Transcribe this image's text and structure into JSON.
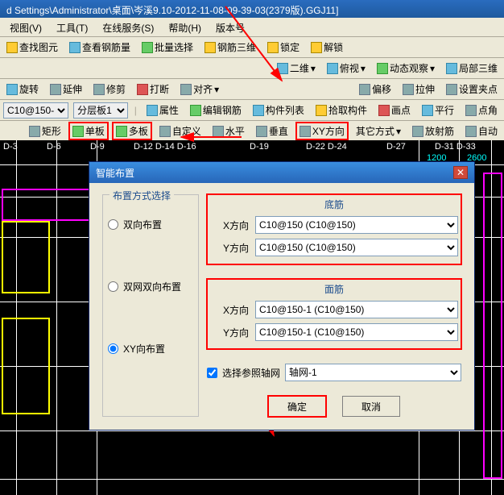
{
  "titlebar": "d Settings\\Administrator\\桌面\\岑溪9.10-2012-11-08-09-39-03(2379版).GGJ11]",
  "menu": [
    "视图(V)",
    "工具(T)",
    "在线服务(S)",
    "帮助(H)",
    "版本号"
  ],
  "tb1": {
    "find": "查找图元",
    "rebar": "查看钢筋量",
    "batch": "批量选择",
    "rebar3d": "钢筋三维",
    "lock": "锁定",
    "unlock": "解锁"
  },
  "tb2": {
    "d2": "二维",
    "pan": "俯视",
    "obs": "动态观察",
    "local3d": "局部三维"
  },
  "tb3": {
    "rotate": "旋转",
    "extend": "延伸",
    "trim": "修剪",
    "break": "打断",
    "align": "对齐",
    "offset": "偏移",
    "stretch": "拉伸",
    "pivot": "设置夹点"
  },
  "tb4": {
    "combo": "C10@150-",
    "layer": "分层板1",
    "props": "属性",
    "editrebar": "编辑钢筋",
    "complist": "构件列表",
    "pick": "拾取构件",
    "drawpt": "画点",
    "parallel": "平行",
    "ptangle": "点角"
  },
  "tb5": {
    "rect": "矩形",
    "single": "单板",
    "multi": "多板",
    "custom": "自定义",
    "hor": "水平",
    "vert": "垂直",
    "xy": "XY方向",
    "other": "其它方式",
    "radial": "放射筋",
    "auto": "自动"
  },
  "gridlabels": [
    "D-3",
    "D-6",
    "D-9",
    "D-12 D-14 D-16",
    "D-19",
    "D-22 D-24",
    "D-27",
    "D-31 D-33"
  ],
  "gridtop": [
    "1200",
    "2600"
  ],
  "dialog": {
    "title": "智能布置",
    "groupTitle": "布置方式选择",
    "radios": [
      "双向布置",
      "双网双向布置",
      "XY向布置"
    ],
    "bottomRebar": "底筋",
    "topRebar": "面筋",
    "xdir": "X方向",
    "ydir": "Y方向",
    "bx": "C10@150 (C10@150)",
    "by": "C10@150 (C10@150)",
    "tx": "C10@150-1 (C10@150)",
    "ty": "C10@150-1 (C10@150)",
    "axisCheck": "选择参照轴网",
    "axisCombo": "轴网-1",
    "ok": "确定",
    "cancel": "取消"
  }
}
